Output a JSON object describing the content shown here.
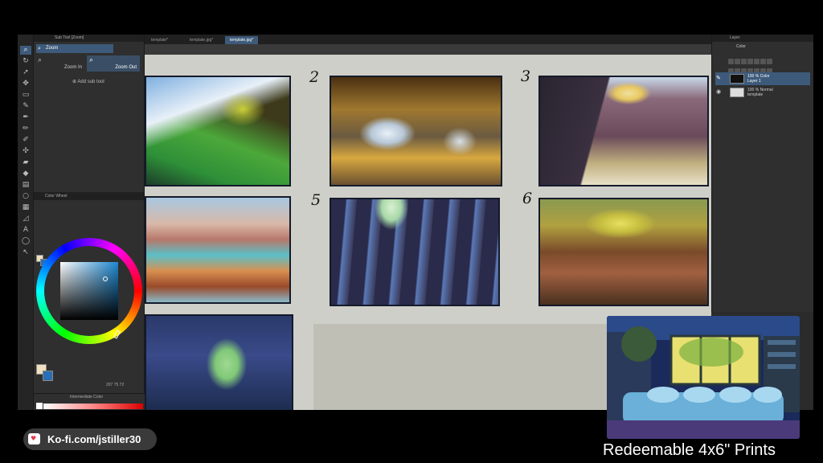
{
  "subtool_panel": {
    "tab_title": "Sub Tool [Zoom]",
    "selected_tool": "Zoom",
    "zoom_in_label": "Zoom In",
    "zoom_out_label": "Zoom Out",
    "add_sub_tool_label": "Add sub tool"
  },
  "color_panel": {
    "tab_title": "Color Wheel",
    "hsv": "207  75  72",
    "intermediate_label": "Intermediate Color",
    "foreground_color": "#f0e0c0",
    "background_color": "#2a6fb5"
  },
  "document_tabs": [
    {
      "label": "template*"
    },
    {
      "label": "template.jpg*"
    },
    {
      "label": "template.jpg*"
    }
  ],
  "canvas": {
    "thumbnail_numbers": [
      "2",
      "3",
      "5",
      "6"
    ]
  },
  "layer_panel": {
    "tab_title": "Layer",
    "blend_mode": "Color",
    "layers": [
      {
        "opacity_mode": "100 % Color",
        "name": "Layer 1"
      },
      {
        "opacity_mode": "100 % Normal",
        "name": "template"
      }
    ]
  },
  "overlay": {
    "kofi_text": "Ko-fi.com/jstiller30",
    "prints_text": "Redeemable 4x6\" Prints"
  },
  "colors": {
    "accent": "#3d5a7a",
    "panel": "#2f2f2f",
    "paper": "#cfcfc9"
  }
}
